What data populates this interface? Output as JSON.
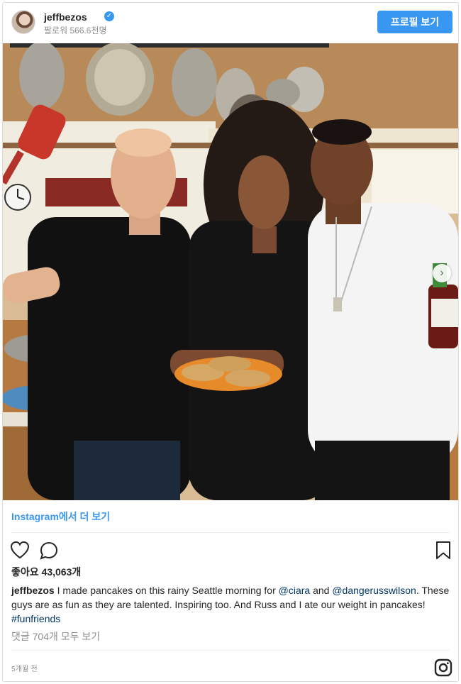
{
  "header": {
    "username": "jeffbezos",
    "verified_icon": "verified-badge-icon",
    "followers": "팔로워 566.6천명",
    "profile_button": "프로필 보기"
  },
  "photo": {
    "carousel_next_icon": "chevron-right-icon"
  },
  "more_link": "Instagram에서 더 보기",
  "actions": {
    "like_icon": "heart-icon",
    "comment_icon": "comment-icon",
    "save_icon": "bookmark-icon"
  },
  "likes": "좋아요 43,063개",
  "caption": {
    "user": "jeffbezos",
    "text_1": " I made pancakes on this rainy Seattle morning for ",
    "mention_1": "@ciara",
    "text_2": " and ",
    "mention_2": "@dangerusswilson",
    "text_3": ". These guys are as fun as they are talented. Inspiring too. And Russ and I ate our weight in pancakes! ",
    "hashtag": "#funfriends"
  },
  "comments_link": "댓글 704개 모두 보기",
  "timestamp": "5개월 전",
  "footer": {
    "instagram_icon": "instagram-logo-icon"
  },
  "colors": {
    "accent": "#3897f0",
    "link": "#003569",
    "muted": "#8e8e8e",
    "text": "#262626"
  }
}
